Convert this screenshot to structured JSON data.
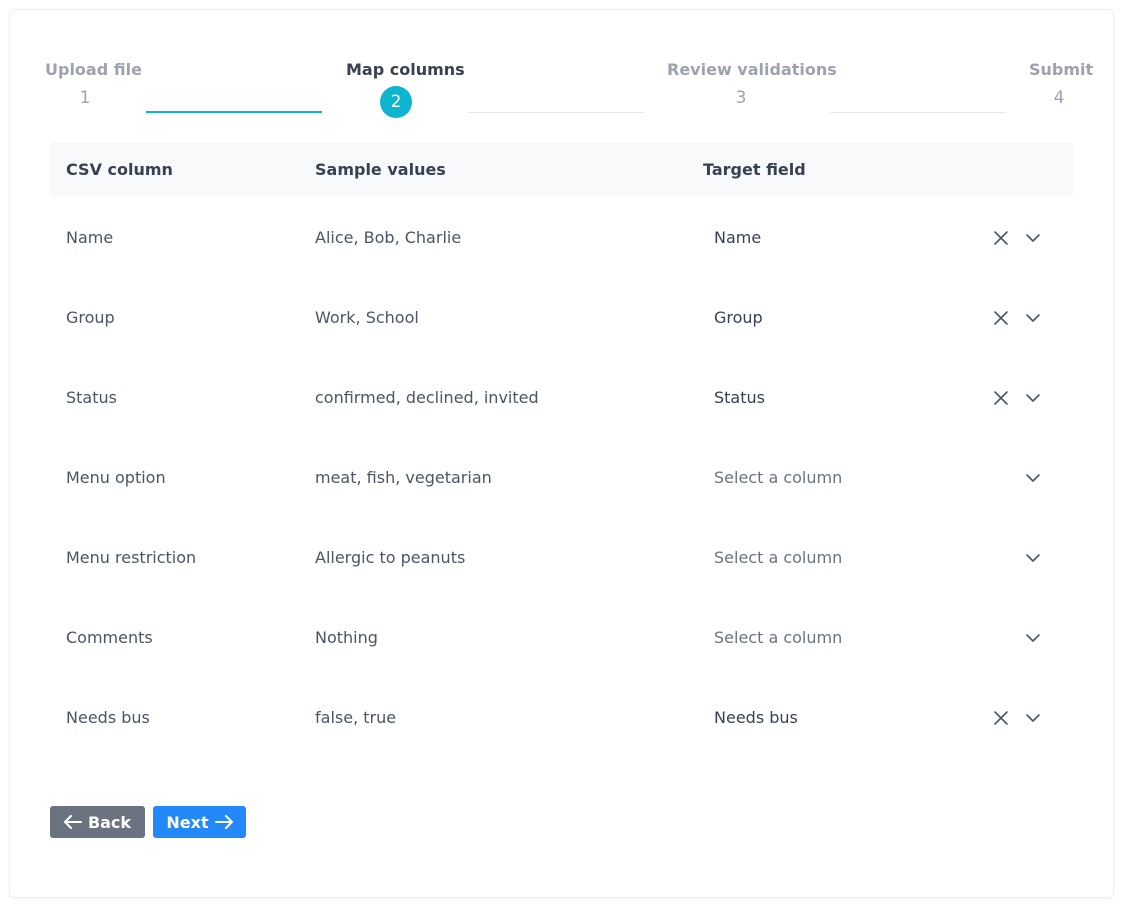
{
  "stepper": {
    "steps": [
      {
        "label": "Upload file",
        "number": "1",
        "state": "done"
      },
      {
        "label": "Map columns",
        "number": "2",
        "state": "active"
      },
      {
        "label": "Review validations",
        "number": "3",
        "state": "todo"
      },
      {
        "label": "Submit",
        "number": "4",
        "state": "todo"
      }
    ]
  },
  "table": {
    "headers": {
      "csv_column": "CSV column",
      "sample_values": "Sample values",
      "target_field": "Target field"
    },
    "rows": [
      {
        "csv_column": "Name",
        "sample_values": "Alice, Bob, Charlie",
        "target": "Name",
        "mapped": true
      },
      {
        "csv_column": "Group",
        "sample_values": "Work, School",
        "target": "Group",
        "mapped": true
      },
      {
        "csv_column": "Status",
        "sample_values": "confirmed, declined, invited",
        "target": "Status",
        "mapped": true
      },
      {
        "csv_column": "Menu option",
        "sample_values": "meat, fish, vegetarian",
        "target": "Select a column",
        "mapped": false
      },
      {
        "csv_column": "Menu restriction",
        "sample_values": "Allergic to peanuts",
        "target": "Select a column",
        "mapped": false
      },
      {
        "csv_column": "Comments",
        "sample_values": "Nothing",
        "target": "Select a column",
        "mapped": false
      },
      {
        "csv_column": "Needs bus",
        "sample_values": "false, true",
        "target": "Needs bus",
        "mapped": true
      }
    ]
  },
  "actions": {
    "back_label": "Back",
    "next_label": "Next"
  },
  "colors": {
    "accent": "#0eb5d0",
    "primary_button": "#2389f8",
    "secondary_button": "#6b7280"
  }
}
